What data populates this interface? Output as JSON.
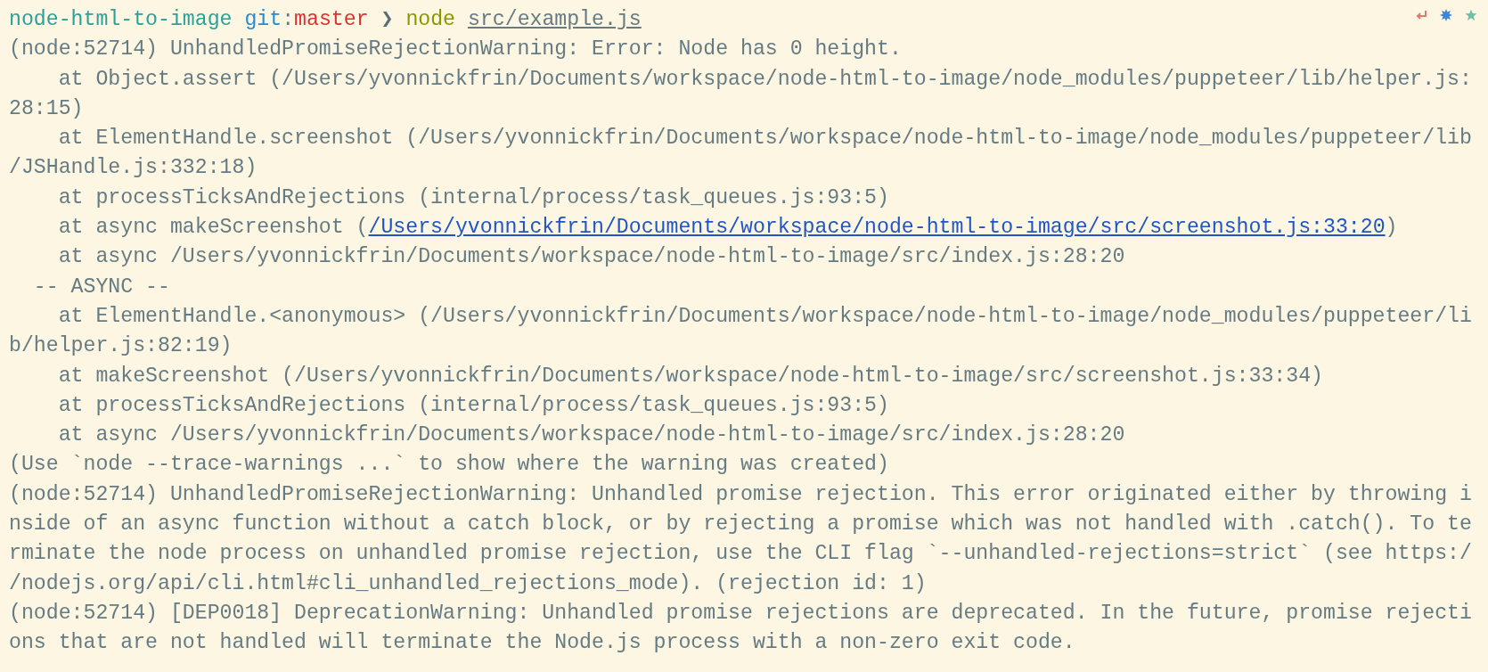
{
  "prompt": {
    "directory": "node-html-to-image",
    "git_label": "git",
    "separator": ":",
    "branch": "master",
    "arrow": "❯",
    "command": "node",
    "argument": "src/example.js"
  },
  "output": [
    {
      "kind": "plain",
      "text": "(node:52714) UnhandledPromiseRejectionWarning: Error: Node has 0 height."
    },
    {
      "kind": "plain",
      "text": "    at Object.assert (/Users/yvonnickfrin/Documents/workspace/node-html-to-image/node_modules/puppeteer/lib/helper.js:"
    },
    {
      "kind": "plain",
      "text": "28:15)"
    },
    {
      "kind": "plain",
      "text": "    at ElementHandle.screenshot (/Users/yvonnickfrin/Documents/workspace/node-html-to-image/node_modules/puppeteer/lib"
    },
    {
      "kind": "plain",
      "text": "/JSHandle.js:332:18)"
    },
    {
      "kind": "plain",
      "text": "    at processTicksAndRejections (internal/process/task_queues.js:93:5)"
    },
    {
      "kind": "link",
      "before": "    at async makeScreenshot (",
      "link": "/Users/yvonnickfrin/Documents/workspace/node-html-to-image/src/screenshot.js:33:20",
      "after": ")"
    },
    {
      "kind": "plain",
      "text": "    at async /Users/yvonnickfrin/Documents/workspace/node-html-to-image/src/index.js:28:20"
    },
    {
      "kind": "plain",
      "text": "  -- ASYNC --"
    },
    {
      "kind": "plain",
      "text": "    at ElementHandle.<anonymous> (/Users/yvonnickfrin/Documents/workspace/node-html-to-image/node_modules/puppeteer/li"
    },
    {
      "kind": "plain",
      "text": "b/helper.js:82:19)"
    },
    {
      "kind": "plain",
      "text": "    at makeScreenshot (/Users/yvonnickfrin/Documents/workspace/node-html-to-image/src/screenshot.js:33:34)"
    },
    {
      "kind": "plain",
      "text": "    at processTicksAndRejections (internal/process/task_queues.js:93:5)"
    },
    {
      "kind": "plain",
      "text": "    at async /Users/yvonnickfrin/Documents/workspace/node-html-to-image/src/index.js:28:20"
    },
    {
      "kind": "plain",
      "text": "(Use `node --trace-warnings ...` to show where the warning was created)"
    },
    {
      "kind": "plain",
      "text": "(node:52714) UnhandledPromiseRejectionWarning: Unhandled promise rejection. This error originated either by throwing i"
    },
    {
      "kind": "plain",
      "text": "nside of an async function without a catch block, or by rejecting a promise which was not handled with .catch(). To te"
    },
    {
      "kind": "plain",
      "text": "rminate the node process on unhandled promise rejection, use the CLI flag `--unhandled-rejections=strict` (see https:/"
    },
    {
      "kind": "plain",
      "text": "/nodejs.org/api/cli.html#cli_unhandled_rejections_mode). (rejection id: 1)"
    },
    {
      "kind": "plain",
      "text": "(node:52714) [DEP0018] DeprecationWarning: Unhandled promise rejections are deprecated. In the future, promise rejecti"
    },
    {
      "kind": "plain",
      "text": "ons that are not handled will terminate the Node.js process with a non-zero exit code."
    }
  ]
}
